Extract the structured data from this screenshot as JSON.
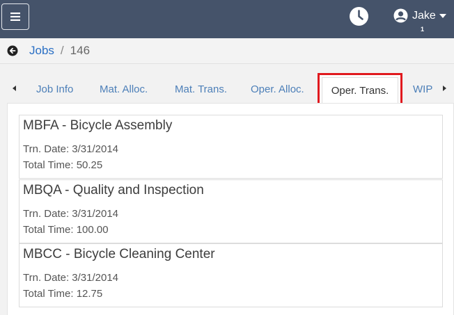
{
  "header": {
    "user_name": "Jake",
    "badge_count": "1"
  },
  "breadcrumb": {
    "parent": "Jobs",
    "separator": "/",
    "current": "146"
  },
  "tabs": [
    {
      "label": "Job Info"
    },
    {
      "label": "Mat. Alloc."
    },
    {
      "label": "Mat. Trans."
    },
    {
      "label": "Oper. Alloc."
    },
    {
      "label": "Oper. Trans."
    },
    {
      "label": "WIP"
    }
  ],
  "active_tab": "Oper. Trans.",
  "transactions": [
    {
      "title": "MBFA - Bicycle Assembly",
      "date": "Trn. Date: 3/31/2014",
      "time": "Total Time: 50.25"
    },
    {
      "title": "MBQA - Quality and Inspection",
      "date": "Trn. Date: 3/31/2014",
      "time": "Total Time: 100.00"
    },
    {
      "title": "MBCC - Bicycle Cleaning Center",
      "date": "Trn. Date: 3/31/2014",
      "time": "Total Time: 12.75"
    }
  ],
  "colors": {
    "header_bg": "#45536a",
    "link": "#2a6fc4",
    "tab_link": "#4c7fb8",
    "highlight": "#e0191e"
  },
  "icons": [
    "hamburger-icon",
    "clock-icon",
    "user-avatar-icon",
    "caret-down-icon",
    "back-arrow-icon",
    "chevron-left-icon",
    "chevron-right-icon"
  ]
}
